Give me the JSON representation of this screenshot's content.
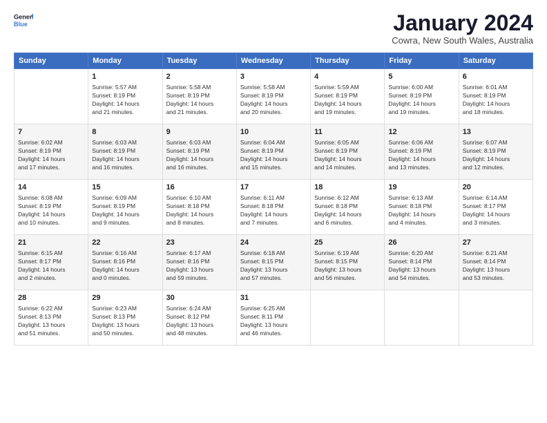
{
  "logo": {
    "line1": "General",
    "line2": "Blue"
  },
  "title": "January 2024",
  "location": "Cowra, New South Wales, Australia",
  "weekdays": [
    "Sunday",
    "Monday",
    "Tuesday",
    "Wednesday",
    "Thursday",
    "Friday",
    "Saturday"
  ],
  "weeks": [
    [
      {
        "day": "",
        "info": ""
      },
      {
        "day": "1",
        "info": "Sunrise: 5:57 AM\nSunset: 8:19 PM\nDaylight: 14 hours\nand 21 minutes."
      },
      {
        "day": "2",
        "info": "Sunrise: 5:58 AM\nSunset: 8:19 PM\nDaylight: 14 hours\nand 21 minutes."
      },
      {
        "day": "3",
        "info": "Sunrise: 5:58 AM\nSunset: 8:19 PM\nDaylight: 14 hours\nand 20 minutes."
      },
      {
        "day": "4",
        "info": "Sunrise: 5:59 AM\nSunset: 8:19 PM\nDaylight: 14 hours\nand 19 minutes."
      },
      {
        "day": "5",
        "info": "Sunrise: 6:00 AM\nSunset: 8:19 PM\nDaylight: 14 hours\nand 19 minutes."
      },
      {
        "day": "6",
        "info": "Sunrise: 6:01 AM\nSunset: 8:19 PM\nDaylight: 14 hours\nand 18 minutes."
      }
    ],
    [
      {
        "day": "7",
        "info": "Sunrise: 6:02 AM\nSunset: 8:19 PM\nDaylight: 14 hours\nand 17 minutes."
      },
      {
        "day": "8",
        "info": "Sunrise: 6:03 AM\nSunset: 8:19 PM\nDaylight: 14 hours\nand 16 minutes."
      },
      {
        "day": "9",
        "info": "Sunrise: 6:03 AM\nSunset: 8:19 PM\nDaylight: 14 hours\nand 16 minutes."
      },
      {
        "day": "10",
        "info": "Sunrise: 6:04 AM\nSunset: 8:19 PM\nDaylight: 14 hours\nand 15 minutes."
      },
      {
        "day": "11",
        "info": "Sunrise: 6:05 AM\nSunset: 8:19 PM\nDaylight: 14 hours\nand 14 minutes."
      },
      {
        "day": "12",
        "info": "Sunrise: 6:06 AM\nSunset: 8:19 PM\nDaylight: 14 hours\nand 13 minutes."
      },
      {
        "day": "13",
        "info": "Sunrise: 6:07 AM\nSunset: 8:19 PM\nDaylight: 14 hours\nand 12 minutes."
      }
    ],
    [
      {
        "day": "14",
        "info": "Sunrise: 6:08 AM\nSunset: 8:19 PM\nDaylight: 14 hours\nand 10 minutes."
      },
      {
        "day": "15",
        "info": "Sunrise: 6:09 AM\nSunset: 8:19 PM\nDaylight: 14 hours\nand 9 minutes."
      },
      {
        "day": "16",
        "info": "Sunrise: 6:10 AM\nSunset: 8:18 PM\nDaylight: 14 hours\nand 8 minutes."
      },
      {
        "day": "17",
        "info": "Sunrise: 6:11 AM\nSunset: 8:18 PM\nDaylight: 14 hours\nand 7 minutes."
      },
      {
        "day": "18",
        "info": "Sunrise: 6:12 AM\nSunset: 8:18 PM\nDaylight: 14 hours\nand 6 minutes."
      },
      {
        "day": "19",
        "info": "Sunrise: 6:13 AM\nSunset: 8:18 PM\nDaylight: 14 hours\nand 4 minutes."
      },
      {
        "day": "20",
        "info": "Sunrise: 6:14 AM\nSunset: 8:17 PM\nDaylight: 14 hours\nand 3 minutes."
      }
    ],
    [
      {
        "day": "21",
        "info": "Sunrise: 6:15 AM\nSunset: 8:17 PM\nDaylight: 14 hours\nand 2 minutes."
      },
      {
        "day": "22",
        "info": "Sunrise: 6:16 AM\nSunset: 8:16 PM\nDaylight: 14 hours\nand 0 minutes."
      },
      {
        "day": "23",
        "info": "Sunrise: 6:17 AM\nSunset: 8:16 PM\nDaylight: 13 hours\nand 59 minutes."
      },
      {
        "day": "24",
        "info": "Sunrise: 6:18 AM\nSunset: 8:15 PM\nDaylight: 13 hours\nand 57 minutes."
      },
      {
        "day": "25",
        "info": "Sunrise: 6:19 AM\nSunset: 8:15 PM\nDaylight: 13 hours\nand 56 minutes."
      },
      {
        "day": "26",
        "info": "Sunrise: 6:20 AM\nSunset: 8:14 PM\nDaylight: 13 hours\nand 54 minutes."
      },
      {
        "day": "27",
        "info": "Sunrise: 6:21 AM\nSunset: 8:14 PM\nDaylight: 13 hours\nand 53 minutes."
      }
    ],
    [
      {
        "day": "28",
        "info": "Sunrise: 6:22 AM\nSunset: 8:13 PM\nDaylight: 13 hours\nand 51 minutes."
      },
      {
        "day": "29",
        "info": "Sunrise: 6:23 AM\nSunset: 8:13 PM\nDaylight: 13 hours\nand 50 minutes."
      },
      {
        "day": "30",
        "info": "Sunrise: 6:24 AM\nSunset: 8:12 PM\nDaylight: 13 hours\nand 48 minutes."
      },
      {
        "day": "31",
        "info": "Sunrise: 6:25 AM\nSunset: 8:11 PM\nDaylight: 13 hours\nand 46 minutes."
      },
      {
        "day": "",
        "info": ""
      },
      {
        "day": "",
        "info": ""
      },
      {
        "day": "",
        "info": ""
      }
    ]
  ]
}
